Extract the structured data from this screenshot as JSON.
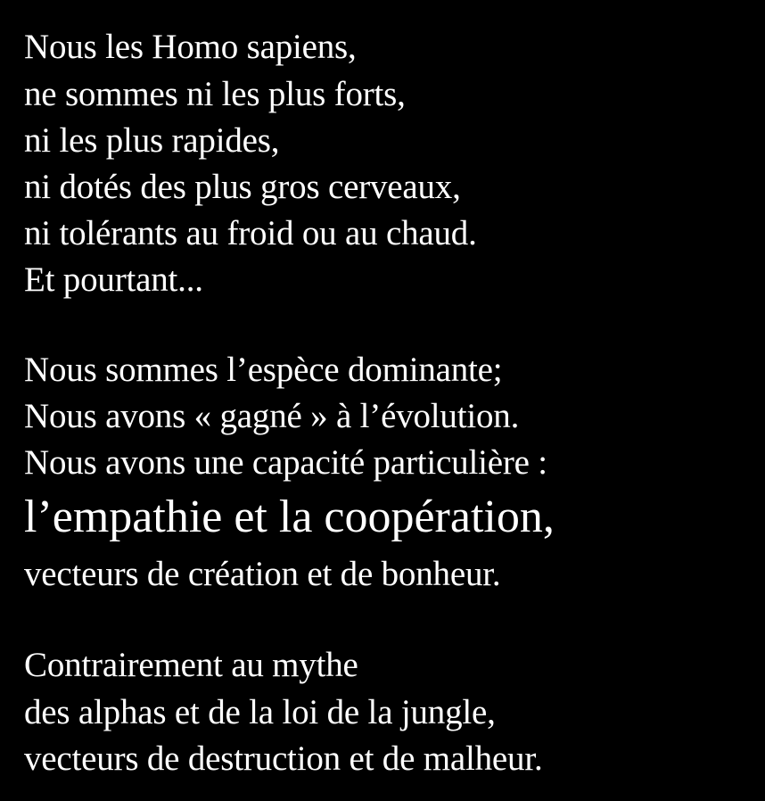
{
  "background_color": "#000000",
  "text_color": "#ffffff",
  "stanza_1": {
    "line_1": "Nous les Homo sapiens,",
    "line_2": "ne sommes ni les plus forts,",
    "line_3": "ni les plus rapides,",
    "line_4": "ni dotés des plus gros cerveaux,",
    "line_5": "ni tolérants au froid ou au chaud.",
    "line_6": "Et pourtant..."
  },
  "stanza_2": {
    "line_1": "Nous sommes l’espèce dominante;",
    "line_2": "Nous avons « gagné » à l’évolution.",
    "line_3": "Nous avons une capacité particulière :",
    "line_4_emphasis": "l’empathie et la coopération,",
    "line_5": "vecteurs de création et de bonheur."
  },
  "stanza_3": {
    "line_1": "Contrairement au mythe",
    "line_2": "des alphas et de la loi de la jungle,",
    "line_3": "vecteurs de destruction et de malheur."
  }
}
